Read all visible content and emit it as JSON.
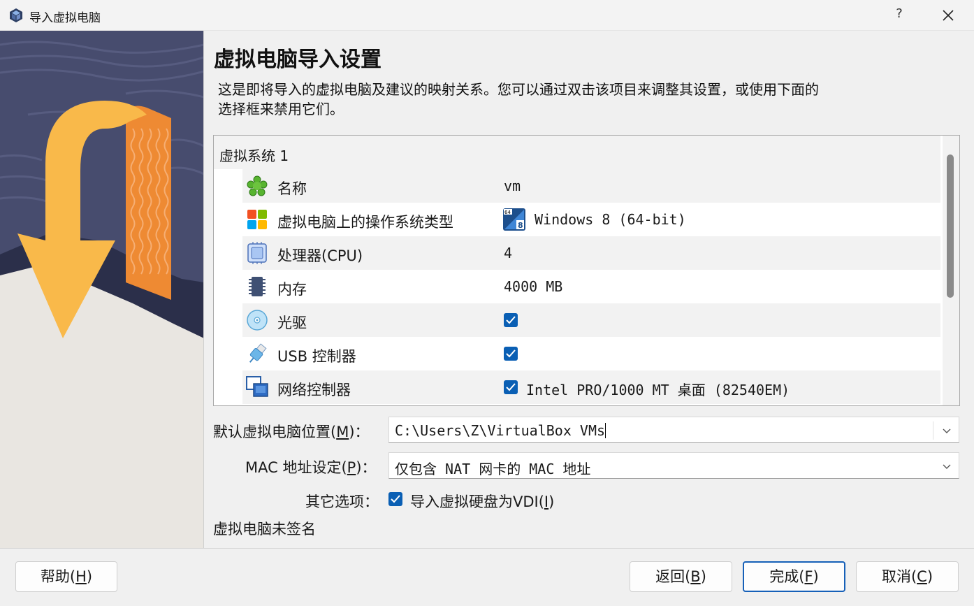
{
  "window": {
    "title": "导入虚拟电脑",
    "help_label": "?"
  },
  "page": {
    "title": "虚拟电脑导入设置",
    "description_line1": "这是即将导入的虚拟电脑及建议的映射关系。您可以通过双击该项目来调整其设置，或使用下面的",
    "description_line2": "选择框来禁用它们。"
  },
  "appliance": {
    "system_header": "虚拟系统 1",
    "rows": [
      {
        "label": "名称",
        "value": "vm",
        "icon": "name-icon"
      },
      {
        "label": "虚拟电脑上的操作系统类型",
        "value": "Windows 8 (64-bit)",
        "icon": "os-type-icon"
      },
      {
        "label": "处理器(CPU)",
        "value": "4",
        "icon": "cpu-icon"
      },
      {
        "label": "内存",
        "value": "4000 MB",
        "icon": "memory-icon"
      },
      {
        "label": "光驱",
        "value": "",
        "checked": true,
        "icon": "optical-drive-icon"
      },
      {
        "label": "USB 控制器",
        "value": "",
        "checked": true,
        "icon": "usb-icon"
      },
      {
        "label": "网络控制器",
        "value": "Intel PRO/1000 MT 桌面 (82540EM)",
        "checked": true,
        "icon": "network-icon"
      }
    ]
  },
  "form": {
    "folder_label_pre": "默认虚拟电脑位置(",
    "folder_label_key": "M",
    "folder_label_post": ")：",
    "folder_value": "C:\\Users\\Z\\VirtualBox VMs",
    "mac_label_pre": "MAC 地址设定(",
    "mac_label_key": "P",
    "mac_label_post": ")：",
    "mac_value": "仅包含 NAT 网卡的 MAC 地址",
    "other_label": "其它选项：",
    "import_vdi_pre": "导入虚拟硬盘为VDI(",
    "import_vdi_key": "I",
    "import_vdi_post": ")",
    "import_vdi_checked": true,
    "signature_status": "虚拟电脑未签名"
  },
  "buttons": {
    "help_pre": "帮助(",
    "help_key": "H",
    "help_post": ")",
    "back_pre": "返回(",
    "back_key": "B",
    "back_post": ")",
    "finish_pre": "完成(",
    "finish_key": "F",
    "finish_post": ")",
    "cancel_pre": "取消(",
    "cancel_key": "C",
    "cancel_post": ")"
  },
  "colors": {
    "accent": "#0a5fb4",
    "default_button_border": "#1660b8",
    "art_orange": "#f9b94a",
    "art_dark": "#474c6e"
  }
}
